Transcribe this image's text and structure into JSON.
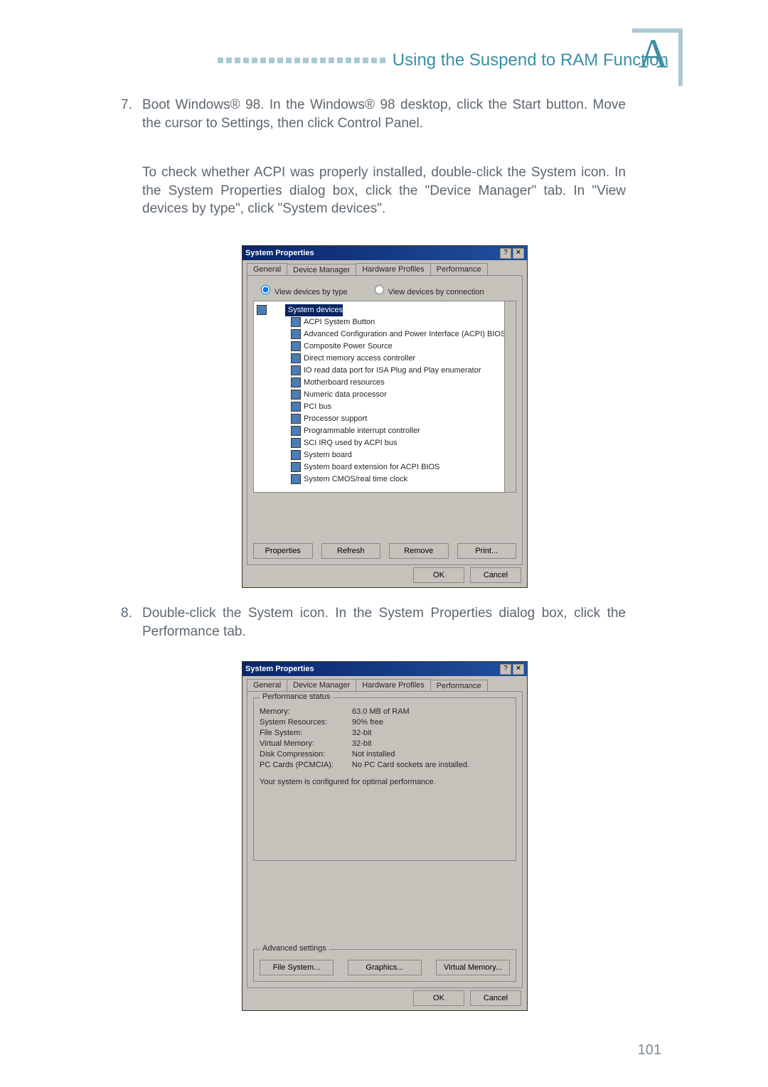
{
  "header": {
    "title": "Using the Suspend to RAM Function"
  },
  "corner_letter": "A",
  "step7": {
    "num": "7.",
    "p1": "Boot Windows® 98. In the Windows® 98 desktop, click the Start button. Move the cursor to Settings, then click Control Panel.",
    "p2": "To check whether ACPI was properly installed, double-click the System icon. In the System Properties dialog box, click the \"Device Manager\" tab. In \"View devices by type\", click \"System devices\"."
  },
  "step8": {
    "num": "8.",
    "p1": "Double-click the System icon. In the System Properties dialog box, click the Performance tab."
  },
  "dlg1": {
    "title": "System Properties",
    "tabs": [
      "General",
      "Device Manager",
      "Hardware Profiles",
      "Performance"
    ],
    "active_tab": 1,
    "radio1": "View devices by type",
    "radio2": "View devices by connection",
    "selected_node": "System devices",
    "tree": [
      "ACPI System Button",
      "Advanced Configuration and Power Interface (ACPI) BIOS",
      "Composite Power Source",
      "Direct memory access controller",
      "IO read data port for ISA Plug and Play enumerator",
      "Motherboard resources",
      "Numeric data processor",
      "PCI bus",
      "Processor support",
      "Programmable interrupt controller",
      "SCI IRQ used by ACPI bus",
      "System board",
      "System board extension for ACPI BIOS",
      "System CMOS/real time clock"
    ],
    "buttons": [
      "Properties",
      "Refresh",
      "Remove",
      "Print..."
    ],
    "footer": [
      "OK",
      "Cancel"
    ]
  },
  "dlg2": {
    "title": "System Properties",
    "tabs": [
      "General",
      "Device Manager",
      "Hardware Profiles",
      "Performance"
    ],
    "active_tab": 3,
    "group1_legend": "Performance status",
    "rows": [
      {
        "k": "Memory:",
        "v": "63.0 MB of RAM"
      },
      {
        "k": "System Resources:",
        "v": "90% free"
      },
      {
        "k": "File System:",
        "v": "32-bit"
      },
      {
        "k": "Virtual Memory:",
        "v": "32-bit"
      },
      {
        "k": "Disk Compression:",
        "v": "Not installed"
      },
      {
        "k": "PC Cards (PCMCIA):",
        "v": "No PC Card sockets are installed."
      }
    ],
    "msg": "Your system is configured for optimal performance.",
    "group2_legend": "Advanced settings",
    "adv_buttons": [
      "File System...",
      "Graphics...",
      "Virtual Memory..."
    ],
    "footer": [
      "OK",
      "Cancel"
    ]
  },
  "page_number": "101"
}
